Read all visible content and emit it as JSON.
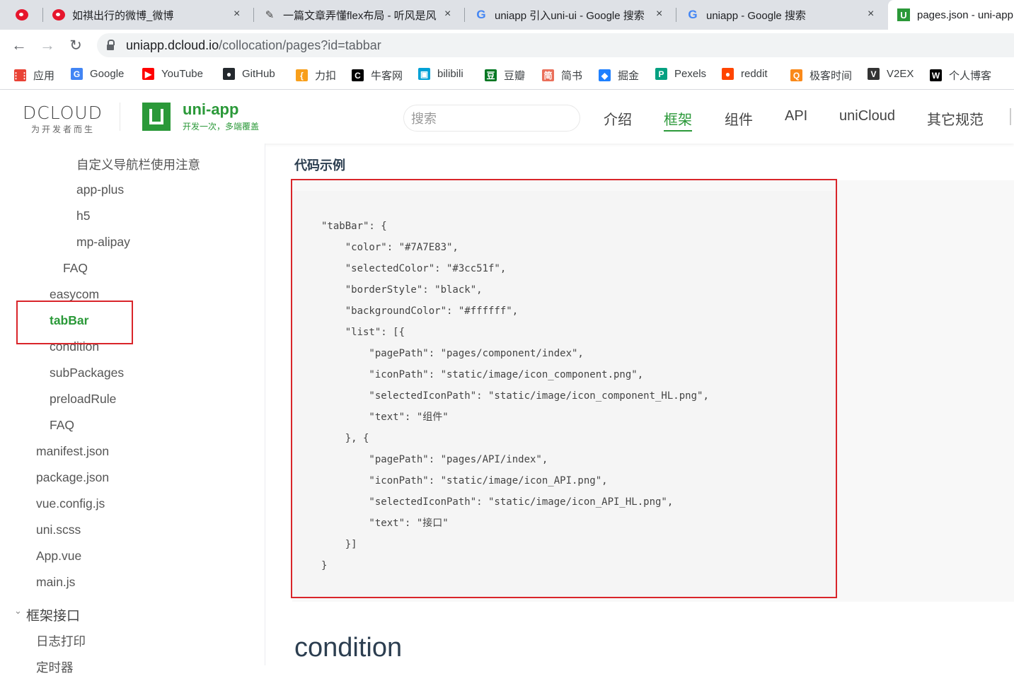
{
  "browser": {
    "tabs": [
      {
        "title": "",
        "icon": "weibo-icon"
      },
      {
        "title": "如祺出行的微博_微博",
        "icon": "weibo-icon"
      },
      {
        "title": "一篇文章弄懂flex布局 - 听风是风",
        "icon": "zhihu-icon"
      },
      {
        "title": "uniapp 引入uni-ui - Google 搜索",
        "icon": "google-icon"
      },
      {
        "title": "uniapp - Google 搜索",
        "icon": "google-icon"
      },
      {
        "title": "pages.json - uni-app",
        "icon": "uniapp-icon"
      }
    ],
    "close_glyph": "×",
    "url_host": "uniapp.dcloud.io",
    "url_path": "/collocation/pages?id=tabbar",
    "bookmarks": [
      {
        "label": "应用",
        "icon": "apps-grid-icon",
        "color": "#e94235"
      },
      {
        "label": "Google",
        "icon": "google-icon",
        "color": "#4285f4"
      },
      {
        "label": "YouTube",
        "icon": "youtube-icon",
        "color": "#ff0000"
      },
      {
        "label": "GitHub",
        "icon": "github-icon",
        "color": "#24292e"
      },
      {
        "label": "力扣",
        "icon": "leetcode-icon",
        "color": "#f89f1b"
      },
      {
        "label": "牛客网",
        "icon": "nowcoder-icon",
        "color": "#000000"
      },
      {
        "label": "bilibili",
        "icon": "bilibili-icon",
        "color": "#00a1d6"
      },
      {
        "label": "豆瓣",
        "icon": "douban-icon",
        "color": "#007722"
      },
      {
        "label": "简书",
        "icon": "jianshu-icon",
        "color": "#ea6f5a"
      },
      {
        "label": "掘金",
        "icon": "juejin-icon",
        "color": "#1e80ff"
      },
      {
        "label": "Pexels",
        "icon": "pexels-icon",
        "color": "#05a081"
      },
      {
        "label": "reddit",
        "icon": "reddit-icon",
        "color": "#ff4500"
      },
      {
        "label": "极客时间",
        "icon": "geektime-icon",
        "color": "#fa8919"
      },
      {
        "label": "V2EX",
        "icon": "v2ex-icon",
        "color": "#333333"
      },
      {
        "label": "个人博客",
        "icon": "blog-icon",
        "color": "#000000"
      }
    ]
  },
  "site": {
    "brand_word": "DCLOUD",
    "brand_tagline": "为开发者而生",
    "product_name": "uni-app",
    "product_tagline": "开发一次，多端覆盖",
    "search_placeholder": "搜索",
    "nav": [
      "介绍",
      "框架",
      "组件",
      "API",
      "uniCloud",
      "其它规范"
    ],
    "active_nav": "框架",
    "accent_color": "#2b9939"
  },
  "sidebar": {
    "items": [
      "自定义导航栏使用注意",
      "app-plus",
      "h5",
      "mp-alipay",
      "FAQ",
      "easycom",
      "tabBar",
      "condition",
      "subPackages",
      "preloadRule",
      "FAQ",
      "manifest.json",
      "package.json",
      "vue.config.js",
      "uni.scss",
      "App.vue",
      "main.js",
      "框架接口",
      "日志打印",
      "定时器"
    ],
    "active_item": "tabBar",
    "highlight_color": "#d9252a"
  },
  "main": {
    "section_title": "代码示例",
    "code": "\"tabBar\": {\n    \"color\": \"#7A7E83\",\n    \"selectedColor\": \"#3cc51f\",\n    \"borderStyle\": \"black\",\n    \"backgroundColor\": \"#ffffff\",\n    \"list\": [{\n        \"pagePath\": \"pages/component/index\",\n        \"iconPath\": \"static/image/icon_component.png\",\n        \"selectedIconPath\": \"static/image/icon_component_HL.png\",\n        \"text\": \"组件\"\n    }, {\n        \"pagePath\": \"pages/API/index\",\n        \"iconPath\": \"static/image/icon_API.png\",\n        \"selectedIconPath\": \"static/image/icon_API_HL.png\",\n        \"text\": \"接口\"\n    }]\n}",
    "next_heading": "condition"
  }
}
